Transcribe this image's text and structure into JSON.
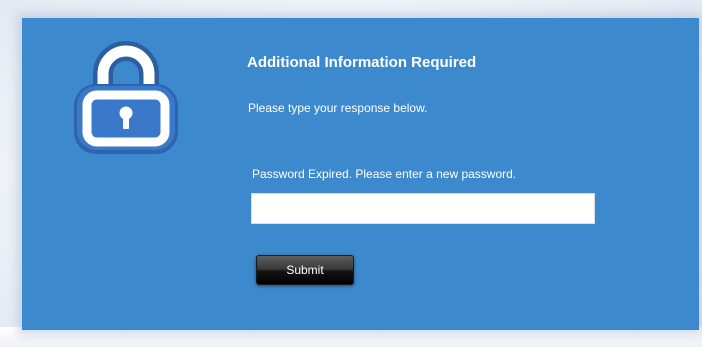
{
  "dialog": {
    "title": "Additional Information Required",
    "subtitle": "Please type your response below.",
    "field_label": "Password Expired. Please enter a new password.",
    "field_value": "",
    "field_placeholder": "",
    "submit_label": "Submit"
  },
  "icons": {
    "lock": "lock-icon"
  },
  "colors": {
    "panel_background": "#3d89ce",
    "icon_background": "#3a78c9",
    "button_background": "#1a1a1a",
    "text": "#ffffff"
  }
}
